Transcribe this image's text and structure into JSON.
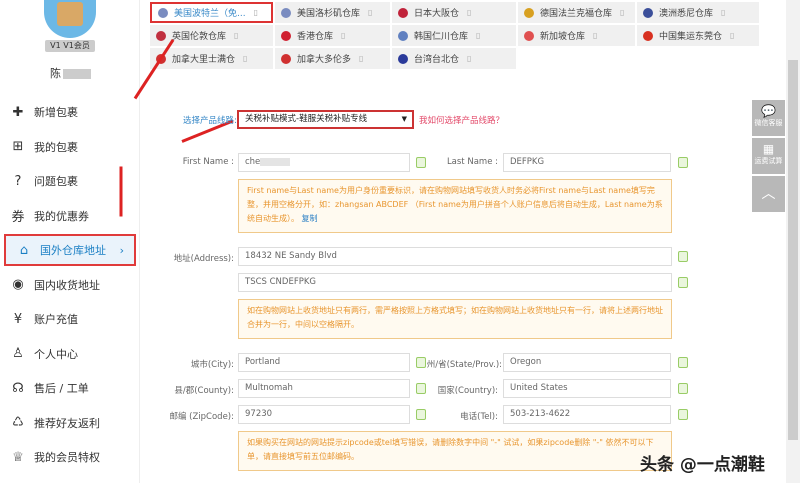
{
  "user": {
    "level_badge": "V1",
    "level_label": "V1会员",
    "name": "陈"
  },
  "sidebar": {
    "items": [
      {
        "label": "新增包裹",
        "icon": "plus-icon",
        "glyph": "✚"
      },
      {
        "label": "我的包裹",
        "icon": "gift-icon",
        "glyph": "⊞"
      },
      {
        "label": "问题包裹",
        "icon": "question-icon",
        "glyph": "?"
      },
      {
        "label": "我的优惠券",
        "icon": "coupon-icon",
        "glyph": "券"
      },
      {
        "label": "国外仓库地址",
        "icon": "home-icon",
        "glyph": "⌂",
        "chev": "›"
      },
      {
        "label": "国内收货地址",
        "icon": "location-icon",
        "glyph": "◉"
      },
      {
        "label": "账户充值",
        "icon": "yen-icon",
        "glyph": "¥"
      },
      {
        "label": "个人中心",
        "icon": "user-icon",
        "glyph": "♙"
      },
      {
        "label": "售后 / 工单",
        "icon": "service-icon",
        "glyph": "☊"
      },
      {
        "label": "推荐好友返利",
        "icon": "share-icon",
        "glyph": "♺"
      },
      {
        "label": "我的会员特权",
        "icon": "crown-icon",
        "glyph": "♕"
      }
    ]
  },
  "warehouses": [
    {
      "label": "美国波特兰（免...",
      "flag": "#7a8cc0",
      "selected": true
    },
    {
      "label": "美国洛杉矶仓库",
      "flag": "#7a8cc0"
    },
    {
      "label": "日本大阪仓",
      "flag": "#c0223a"
    },
    {
      "label": "德国法兰克福仓库",
      "flag": "#d8a020"
    },
    {
      "label": "澳洲悉尼仓库",
      "flag": "#3b4f9a"
    },
    {
      "label": "英国伦敦仓库",
      "flag": "#c03040"
    },
    {
      "label": "香港仓库",
      "flag": "#d02030"
    },
    {
      "label": "韩国仁川仓库",
      "flag": "#6080c0"
    },
    {
      "label": "新加坡仓库",
      "flag": "#e05050"
    },
    {
      "label": "中国集运东莞仓",
      "flag": "#d83020"
    },
    {
      "label": "加拿大里士满仓",
      "flag": "#d03030"
    },
    {
      "label": "加拿大多伦多",
      "flag": "#d03030"
    },
    {
      "label": "台湾台北仓",
      "flag": "#2a3a9a"
    }
  ],
  "copy_glyph": "▯",
  "form": {
    "route_label": "选择产品线路:",
    "route_value": "关税补贴模式-鞋服关税补贴专线",
    "route_help": "我如何选择产品线路？",
    "first_name_label": "First Name :",
    "first_name": "che",
    "last_name_label": "Last Name :",
    "last_name": "DEFPKG",
    "name_note": "First name与Last name为用户身份重要标识，请在购物网站填写收货人时务必将First name与Last name填写完整，并用空格分开，如：zhangsan ABCDEF （First name为用户拼音个人账户信息后将自动生成，Last name为系统自动生成）。",
    "copy_link": "复制",
    "address_label": "地址(Address):",
    "address1": "18432 NE Sandy Blvd",
    "address2": "TSCS CNDEFPKG",
    "address_note": "如在购物网站上收货地址只有两行，需严格按照上方格式填写；如在购物网站上收货地址只有一行，请将上述两行地址合并为一行，中间以空格隔开。",
    "city_label": "城市(City):",
    "city": "Portland",
    "state_label": "州/省(State/Prov.):",
    "state": "Oregon",
    "county_label": "县/郡(County):",
    "county": "Multnomah",
    "country_label": "国家(Country):",
    "country": "United States",
    "zip_label": "邮编 (ZipCode):",
    "zip": "97230",
    "tel_label": "电话(Tel):",
    "tel": "503-213-4622",
    "zip_note": "如果购买在网站的网站提示zipcode或tel填写错误，请删除数字中间 \"-\" 试试，如果zipcode删除 \"-\" 依然不可以下单，请直接填写前五位邮编码。"
  },
  "right_tools": {
    "chat": "微信客服",
    "calc": "运费试算",
    "top": "︿"
  },
  "watermark": "头条 @一点潮鞋"
}
